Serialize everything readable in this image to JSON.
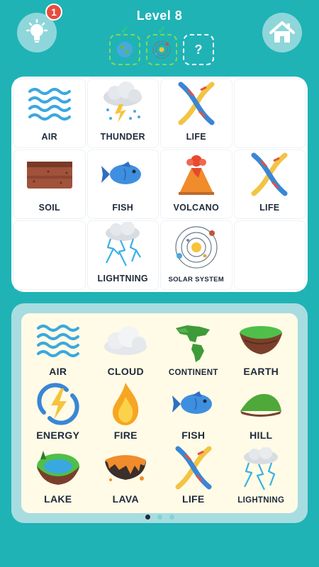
{
  "header": {
    "level_title": "Level 8",
    "hint_badge": "1",
    "goals": [
      {
        "icon": "earth-icon",
        "done": true
      },
      {
        "icon": "solar-system-icon",
        "done": true
      },
      {
        "icon": "unknown",
        "done": false,
        "text": "?"
      }
    ]
  },
  "board": {
    "cells": [
      {
        "label": "AIR",
        "icon": "air-icon"
      },
      {
        "label": "THUNDER",
        "icon": "thunder-icon"
      },
      {
        "label": "LIFE",
        "icon": "dna-icon"
      },
      {
        "label": "",
        "icon": ""
      },
      {
        "label": "SOIL",
        "icon": "soil-icon"
      },
      {
        "label": "FISH",
        "icon": "fish-icon"
      },
      {
        "label": "VOLCANO",
        "icon": "volcano-icon"
      },
      {
        "label": "LIFE",
        "icon": "dna-icon"
      },
      {
        "label": "",
        "icon": ""
      },
      {
        "label": "LIGHTNING",
        "icon": "lightning-icon"
      },
      {
        "label": "SOLAR SYSTEM",
        "icon": "solar-system-icon"
      },
      {
        "label": "",
        "icon": ""
      }
    ]
  },
  "inventory": {
    "items": [
      {
        "label": "AIR",
        "icon": "air-icon"
      },
      {
        "label": "CLOUD",
        "icon": "cloud-icon"
      },
      {
        "label": "CONTINENT",
        "icon": "continent-icon"
      },
      {
        "label": "EARTH",
        "icon": "earth-island-icon"
      },
      {
        "label": "ENERGY",
        "icon": "energy-icon"
      },
      {
        "label": "FIRE",
        "icon": "fire-icon"
      },
      {
        "label": "FISH",
        "icon": "fish-icon"
      },
      {
        "label": "HILL",
        "icon": "hill-icon"
      },
      {
        "label": "LAKE",
        "icon": "lake-icon"
      },
      {
        "label": "LAVA",
        "icon": "lava-icon"
      },
      {
        "label": "LIFE",
        "icon": "dna-icon"
      },
      {
        "label": "LIGHTNING",
        "icon": "lightning-icon"
      }
    ],
    "page_count": 3,
    "active_page": 1
  },
  "colors": {
    "background": "#1fb3b6",
    "button": "#8ed6d9",
    "badge": "#e84c3d",
    "inventory_frame": "#a7dde0",
    "inventory_bg": "#fffbe6"
  }
}
